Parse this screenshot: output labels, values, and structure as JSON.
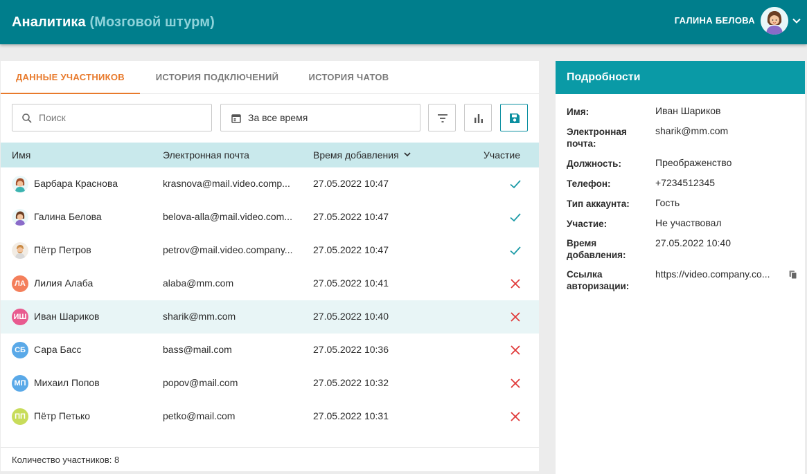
{
  "header": {
    "title": "Аналитика",
    "subtitle": "(Мозговой штурм)",
    "user_name": "ГАЛИНА БЕЛОВА",
    "bar_color": "#007e8c"
  },
  "tabs": [
    {
      "label": "ДАННЫЕ УЧАСТНИКОВ",
      "active": true
    },
    {
      "label": "ИСТОРИЯ ПОДКЛЮЧЕНИЙ",
      "active": false
    },
    {
      "label": "ИСТОРИЯ ЧАТОВ",
      "active": false
    }
  ],
  "toolbar": {
    "search_placeholder": "Поиск",
    "period_label": "За все время",
    "icons": [
      "search-icon",
      "calendar-icon",
      "filter-icon",
      "bar-chart-icon",
      "save-icon"
    ]
  },
  "table": {
    "columns": [
      "Имя",
      "Электронная почта",
      "Время добавления",
      "Участие"
    ],
    "rows": [
      {
        "name": "Барбара Краснова",
        "email": "krasnova@mail.video.comp...",
        "added": "27.05.2022 10:47",
        "participated": true,
        "avatar": "photo",
        "initials": ""
      },
      {
        "name": "Галина Белова",
        "email": "belova-alla@mail.video.com...",
        "added": "27.05.2022 10:47",
        "participated": true,
        "avatar": "photo",
        "initials": ""
      },
      {
        "name": "Пётр Петров",
        "email": "petrov@mail.video.company...",
        "added": "27.05.2022 10:47",
        "participated": true,
        "avatar": "photo",
        "initials": ""
      },
      {
        "name": "Лилия Алаба",
        "email": "alaba@mm.com",
        "added": "27.05.2022 10:41",
        "participated": false,
        "avatar": "initials",
        "initials": "ЛА",
        "avatar_color": "#f47f5b"
      },
      {
        "name": "Иван Шариков",
        "email": "sharik@mm.com",
        "added": "27.05.2022 10:40",
        "participated": false,
        "avatar": "initials",
        "initials": "ИШ",
        "avatar_color": "#e85a8f",
        "selected": true
      },
      {
        "name": "Сара Басс",
        "email": "bass@mail.com",
        "added": "27.05.2022 10:36",
        "participated": false,
        "avatar": "initials",
        "initials": "СБ",
        "avatar_color": "#5aa9e8"
      },
      {
        "name": "Михаил Попов",
        "email": "popov@mail.com",
        "added": "27.05.2022 10:32",
        "participated": false,
        "avatar": "initials",
        "initials": "МП",
        "avatar_color": "#5aa9e8"
      },
      {
        "name": "Пётр Петько",
        "email": "petko@mail.com",
        "added": "27.05.2022 10:31",
        "participated": false,
        "avatar": "initials",
        "initials": "ПП",
        "avatar_color": "#c8dc5a"
      }
    ],
    "check_color": "#1a9aa6",
    "cross_color": "#e03a3a"
  },
  "footer": {
    "count_label": "Количество участников: 8"
  },
  "details": {
    "title": "Подробности",
    "fields": [
      {
        "label": "Имя:",
        "value": "Иван Шариков"
      },
      {
        "label": "Электронная почта:",
        "value": "sharik@mm.com"
      },
      {
        "label": "Должность:",
        "value": "Преображенство"
      },
      {
        "label": "Телефон:",
        "value": "+7234512345"
      },
      {
        "label": "Тип аккаунта:",
        "value": "Гость"
      },
      {
        "label": "Участие:",
        "value": "Не участвовал"
      },
      {
        "label": "Время добавления:",
        "value": "27.05.2022 10:40"
      },
      {
        "label": "Ссылка авторизации:",
        "value": "https://video.company.co..."
      }
    ]
  }
}
